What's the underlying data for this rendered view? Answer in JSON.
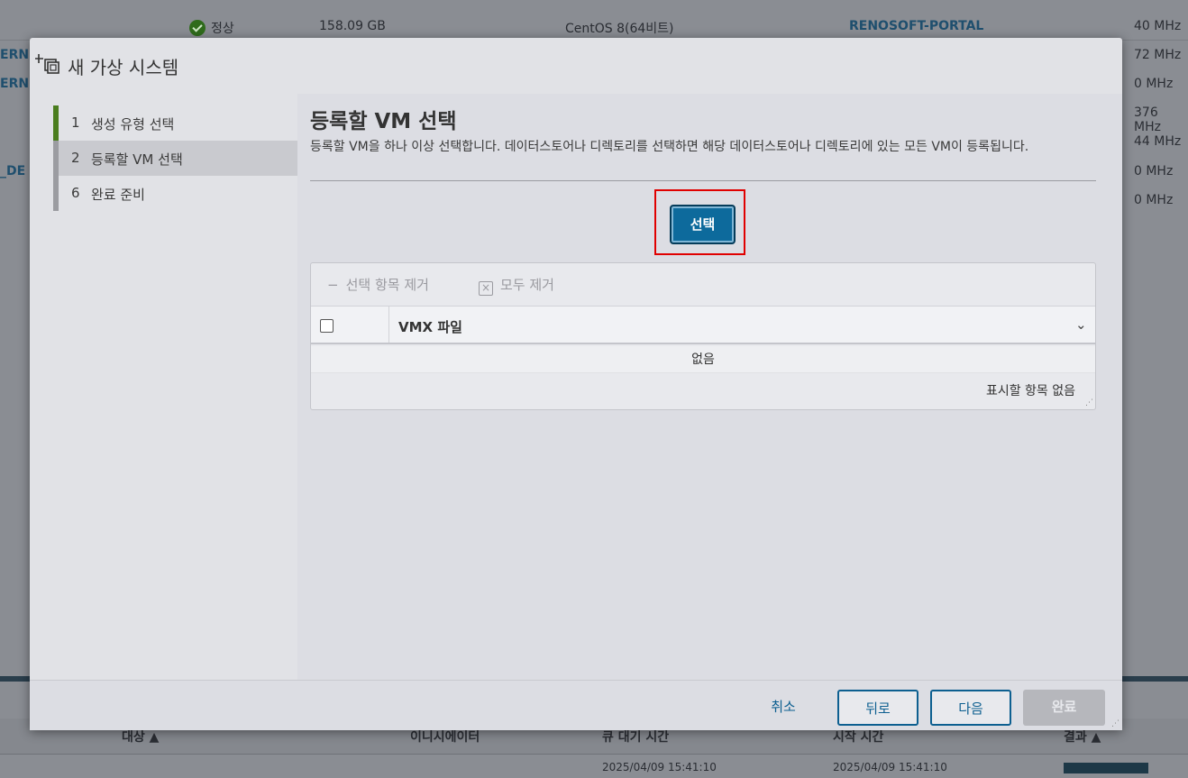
{
  "background": {
    "rows": [
      {
        "status": "정상",
        "size": "158.09 GB",
        "os": "CentOS 8(64비트)",
        "portal": "RENOSOFT-PORTAL",
        "mhz": "40 MHz"
      },
      {
        "left_label": "ERN",
        "mhz": "72 MHz"
      },
      {
        "left_label": "ERN",
        "mhz": "0 MHz"
      },
      {
        "mhz": "376 MHz"
      },
      {
        "mhz": "44 MHz"
      },
      {
        "left_label": "_DE",
        "mhz": "0 MHz"
      },
      {
        "mhz": "0 MHz"
      }
    ],
    "bottom_headers": [
      "대상 ▲",
      "이니시에이터",
      "큐 대기 시간",
      "시작 시간",
      "결과 ▲"
    ],
    "bottom_row": {
      "queued": "2025/04/09 15:41:10",
      "started": "2025/04/09 15:41:10"
    }
  },
  "modal": {
    "title": "새 가상 시스템",
    "icon": "new-vm-icon",
    "steps": [
      {
        "num": "1",
        "label": "생성 유형 선택",
        "state": "done"
      },
      {
        "num": "2",
        "label": "등록할 VM 선택",
        "state": "active"
      },
      {
        "num": "6",
        "label": "완료 준비",
        "state": "pending"
      }
    ],
    "page_title": "등록할 VM 선택",
    "description": "등록할 VM을 하나 이상 선택합니다. 데이터스토어나 디렉토리를 선택하면 해당 데이터스토어나 디렉토리에 있는 모든 VM이 등록됩니다.",
    "select_button": "선택",
    "grid": {
      "remove_selected": "선택 항목 제거",
      "remove_all": "모두 제거",
      "column": "VMX 파일",
      "empty_text": "없음",
      "footer": "표시할 항목 없음"
    },
    "footer": {
      "cancel": "취소",
      "back": "뒤로",
      "next": "다음",
      "finish": "완료"
    }
  },
  "colors": {
    "accent": "#0d6a9c",
    "done_step": "#4a7d1e",
    "highlight": "#e00000"
  }
}
